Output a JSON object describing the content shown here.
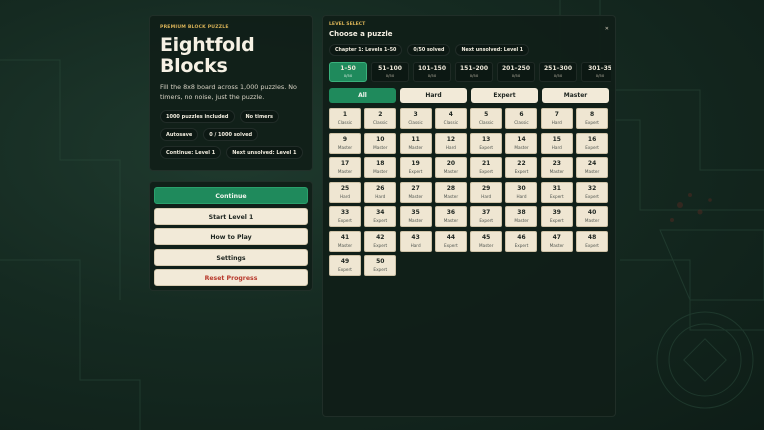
{
  "intro": {
    "eyebrow": "PREMIUM BLOCK PUZZLE",
    "title_line1": "Eightfold",
    "title_line2": "Blocks",
    "description": "Fill the 8x8 board across 1,000 puzzles. No timers, no noise, just the puzzle.",
    "chips": [
      "1000 puzzles included",
      "No timers",
      "Autosave",
      "0 / 1000 solved",
      "Continue: Level 1",
      "Next unsolved: Level 1"
    ]
  },
  "menu": {
    "continue": "Continue",
    "start": "Start Level 1",
    "how_to_play": "How to Play",
    "settings": "Settings",
    "reset": "Reset Progress"
  },
  "level_select": {
    "eyebrow": "LEVEL SELECT",
    "title": "Choose a puzzle",
    "close_label": "✕",
    "chips": [
      "Chapter 1: Levels 1–50",
      "0/50 solved",
      "Next unsolved: Level 1"
    ],
    "ranges": [
      {
        "label": "1–50",
        "count": "0/50"
      },
      {
        "label": "51–100",
        "count": "0/50"
      },
      {
        "label": "101–150",
        "count": "0/50"
      },
      {
        "label": "151–200",
        "count": "0/50"
      },
      {
        "label": "201–250",
        "count": "0/50"
      },
      {
        "label": "251–300",
        "count": "0/50"
      },
      {
        "label": "301–35",
        "count": "0/50"
      }
    ],
    "active_range": 0,
    "filters": [
      "All",
      "Hard",
      "Expert",
      "Master"
    ],
    "active_filter": 0,
    "levels": [
      {
        "n": "1",
        "d": "Classic"
      },
      {
        "n": "2",
        "d": "Classic"
      },
      {
        "n": "3",
        "d": "Classic"
      },
      {
        "n": "4",
        "d": "Classic"
      },
      {
        "n": "5",
        "d": "Classic"
      },
      {
        "n": "6",
        "d": "Classic"
      },
      {
        "n": "7",
        "d": "Hard"
      },
      {
        "n": "8",
        "d": "Expert"
      },
      {
        "n": "9",
        "d": "Master"
      },
      {
        "n": "10",
        "d": "Master"
      },
      {
        "n": "11",
        "d": "Master"
      },
      {
        "n": "12",
        "d": "Hard"
      },
      {
        "n": "13",
        "d": "Expert"
      },
      {
        "n": "14",
        "d": "Master"
      },
      {
        "n": "15",
        "d": "Hard"
      },
      {
        "n": "16",
        "d": "Expert"
      },
      {
        "n": "17",
        "d": "Master"
      },
      {
        "n": "18",
        "d": "Master"
      },
      {
        "n": "19",
        "d": "Expert"
      },
      {
        "n": "20",
        "d": "Master"
      },
      {
        "n": "21",
        "d": "Expert"
      },
      {
        "n": "22",
        "d": "Expert"
      },
      {
        "n": "23",
        "d": "Master"
      },
      {
        "n": "24",
        "d": "Master"
      },
      {
        "n": "25",
        "d": "Hard"
      },
      {
        "n": "26",
        "d": "Hard"
      },
      {
        "n": "27",
        "d": "Master"
      },
      {
        "n": "28",
        "d": "Master"
      },
      {
        "n": "29",
        "d": "Hard"
      },
      {
        "n": "30",
        "d": "Hard"
      },
      {
        "n": "31",
        "d": "Expert"
      },
      {
        "n": "32",
        "d": "Expert"
      },
      {
        "n": "33",
        "d": "Expert"
      },
      {
        "n": "34",
        "d": "Expert"
      },
      {
        "n": "35",
        "d": "Master"
      },
      {
        "n": "36",
        "d": "Master"
      },
      {
        "n": "37",
        "d": "Expert"
      },
      {
        "n": "38",
        "d": "Master"
      },
      {
        "n": "39",
        "d": "Expert"
      },
      {
        "n": "40",
        "d": "Master"
      },
      {
        "n": "41",
        "d": "Master"
      },
      {
        "n": "42",
        "d": "Expert"
      },
      {
        "n": "43",
        "d": "Hard"
      },
      {
        "n": "44",
        "d": "Expert"
      },
      {
        "n": "45",
        "d": "Master"
      },
      {
        "n": "46",
        "d": "Expert"
      },
      {
        "n": "47",
        "d": "Master"
      },
      {
        "n": "48",
        "d": "Expert"
      },
      {
        "n": "49",
        "d": "Expert"
      },
      {
        "n": "50",
        "d": "Expert"
      }
    ]
  },
  "colors": {
    "accent_green": "#1f8a5c",
    "gold": "#d8b257",
    "tile_bg": "#efe6d2",
    "danger": "#b8392c"
  }
}
